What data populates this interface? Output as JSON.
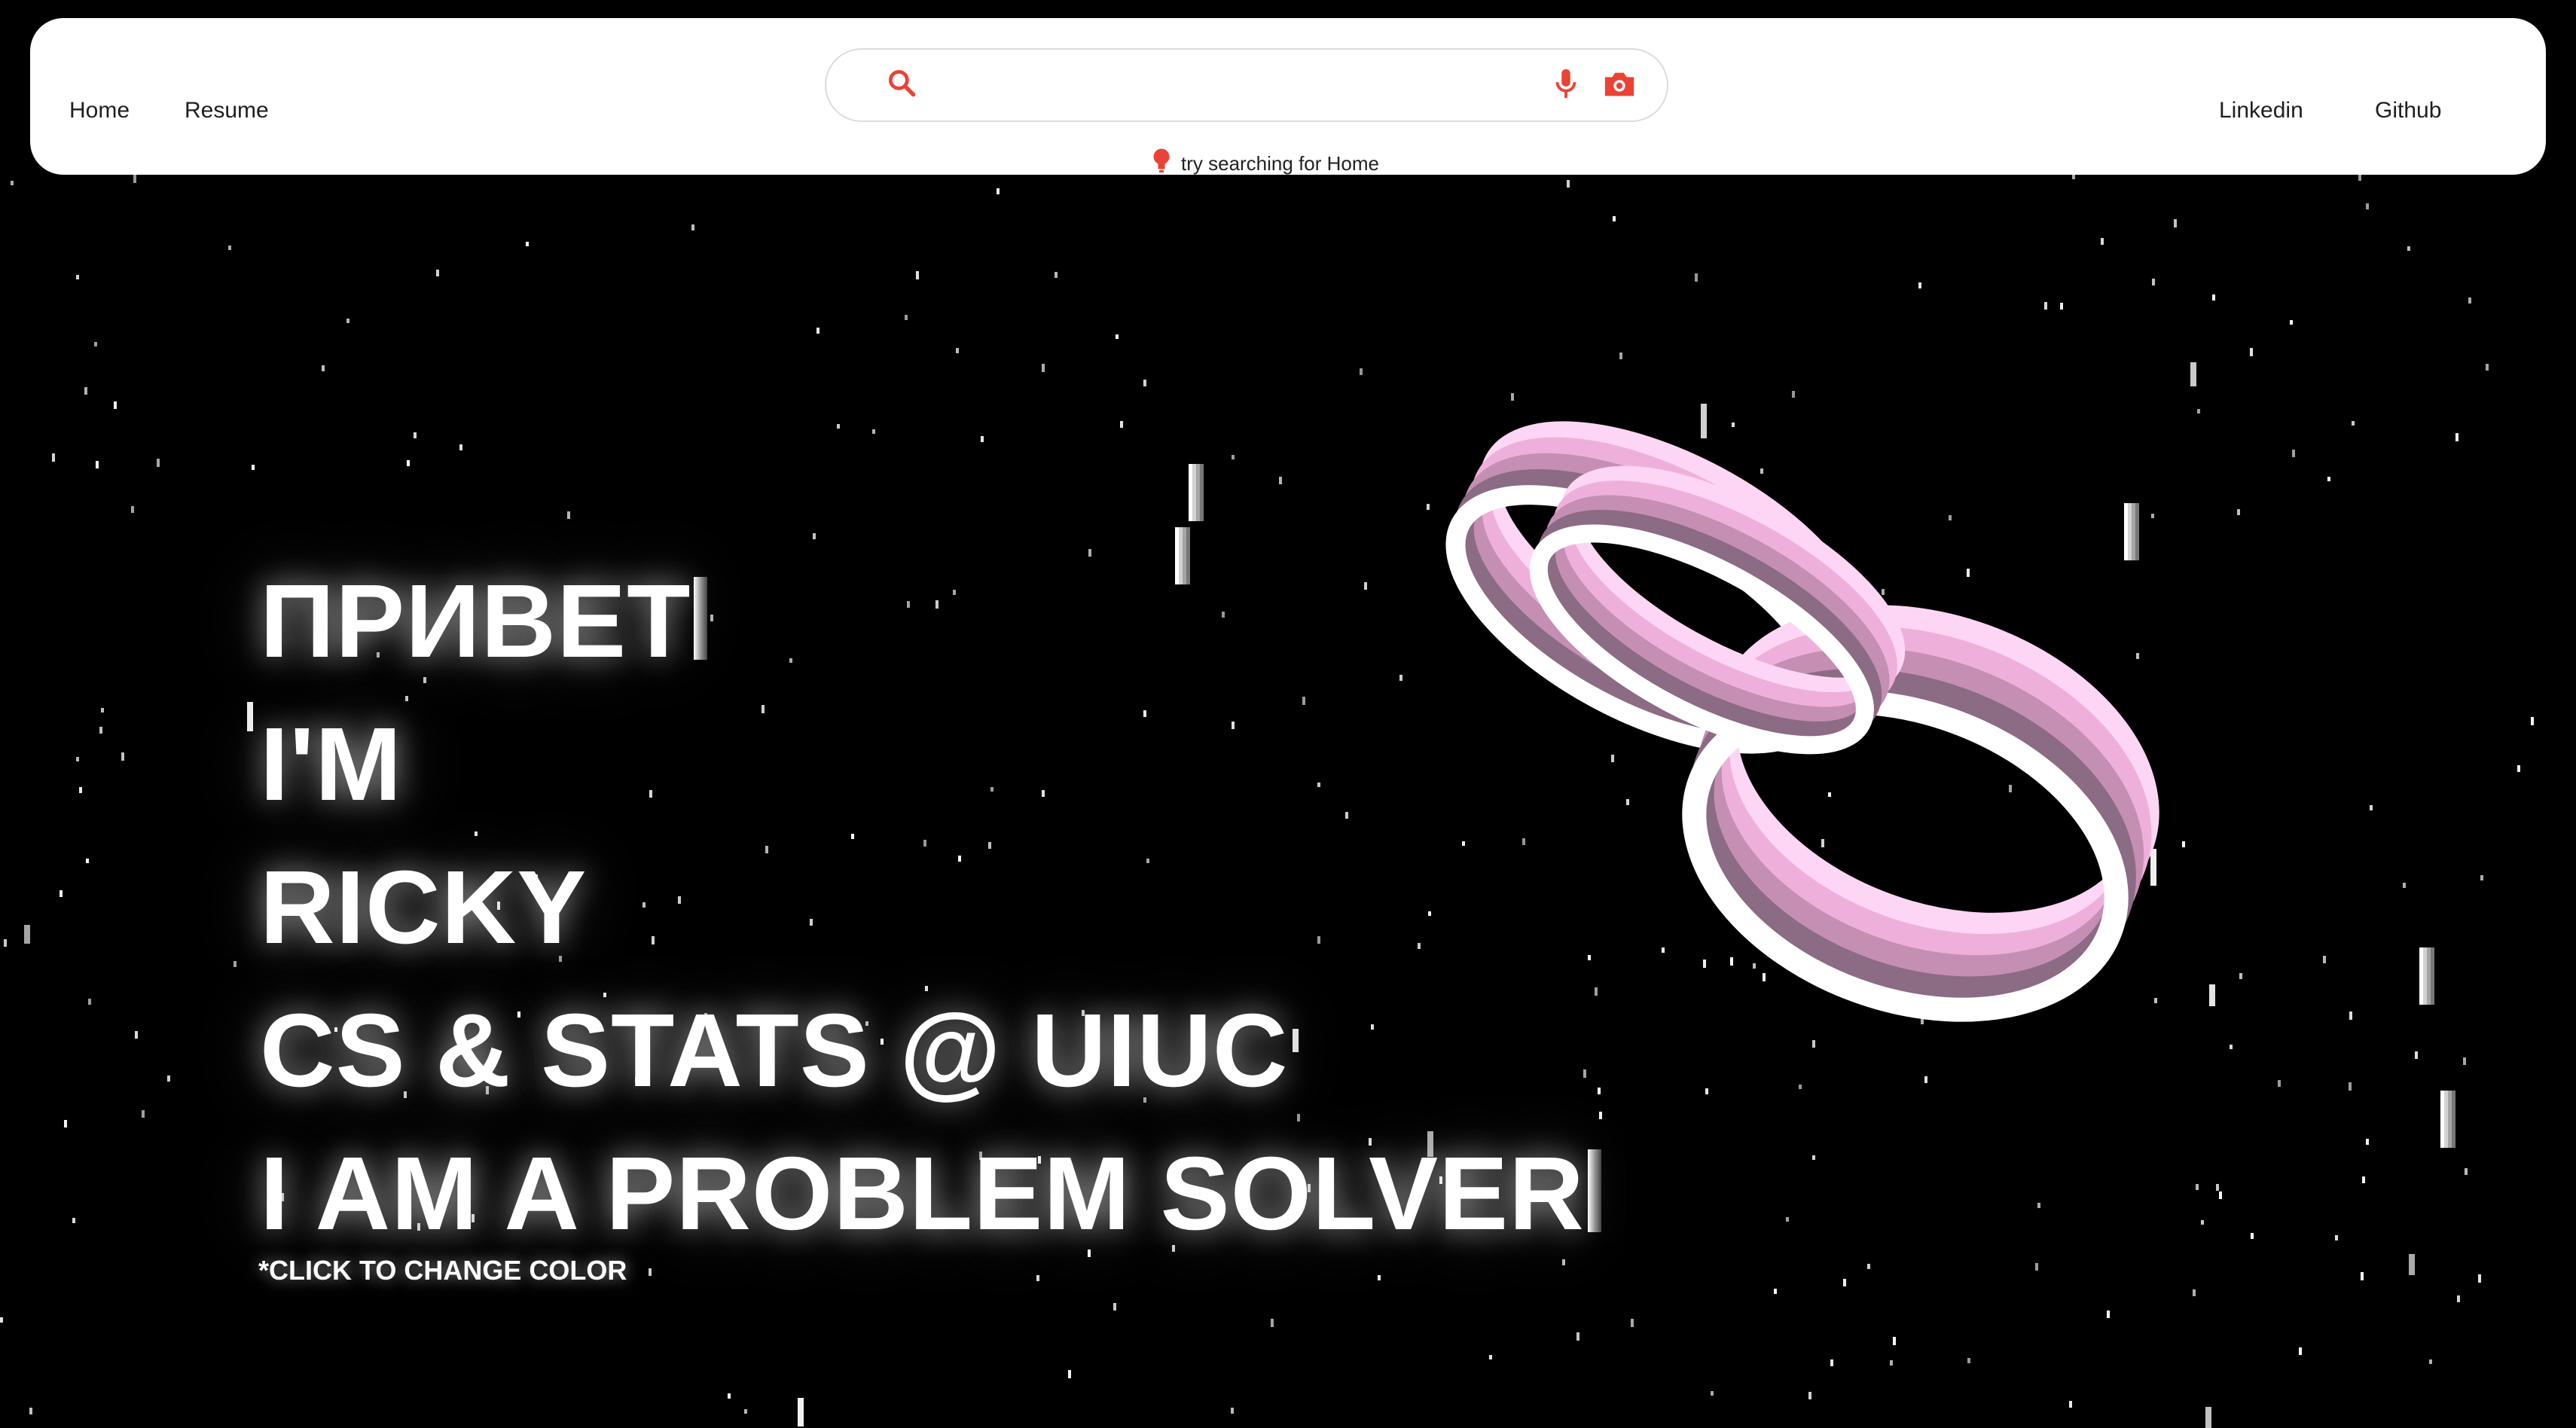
{
  "nav": {
    "left": [
      {
        "label": "Home"
      },
      {
        "label": "Resume"
      }
    ],
    "right": [
      {
        "label": "Linkedin"
      },
      {
        "label": "Github"
      }
    ]
  },
  "search": {
    "value": "",
    "placeholder": "",
    "hint": "try searching for Home",
    "icons": [
      "search-icon",
      "microphone-icon",
      "camera-icon",
      "lightbulb-icon"
    ],
    "accent_color": "#ea4335"
  },
  "hero": {
    "lines": [
      "ПРИВЕТ",
      "I'M",
      "RICKY",
      "CS & STATS @ UIUC",
      "I AM A PROBLEM SOLVER"
    ],
    "click_hint": "*CLICK TO CHANGE COLOR",
    "text_color": "#ffffff"
  },
  "scene": {
    "background": "#000000",
    "object": "torus-knot",
    "object_colors": [
      "#ffffff",
      "#fcd6f4",
      "#eeb0da",
      "#c48fb3",
      "#8c6b85"
    ]
  }
}
